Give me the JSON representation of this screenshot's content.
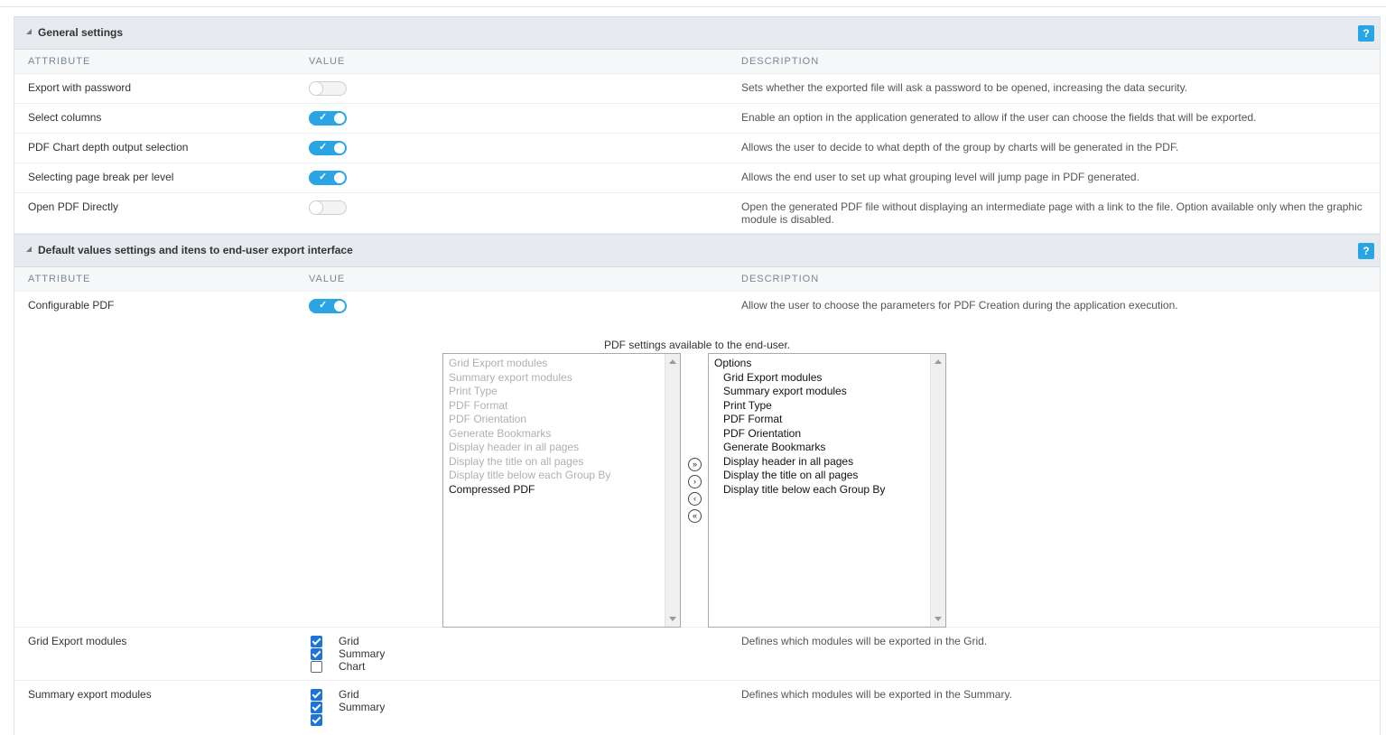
{
  "sections": [
    {
      "title": "General settings",
      "help": "?",
      "columns": {
        "attribute": "ATTRIBUTE",
        "value": "VALUE",
        "description": "DESCRIPTION"
      },
      "rows": [
        {
          "attribute": "Export with password",
          "toggle": "off",
          "description": "Sets whether the exported file will ask a password to be opened, increasing the data security."
        },
        {
          "attribute": "Select columns",
          "toggle": "on",
          "description": "Enable an option in the application generated to allow if the user can choose the fields that will be exported."
        },
        {
          "attribute": "PDF Chart depth output selection",
          "toggle": "on",
          "description": "Allows the user to decide to what depth of the group by charts will be generated in the PDF."
        },
        {
          "attribute": "Selecting page break per level",
          "toggle": "on",
          "description": "Allows the end user to set up what grouping level will jump page in PDF generated."
        },
        {
          "attribute": "Open PDF Directly",
          "toggle": "off",
          "description": "Open the generated PDF file without displaying an intermediate page with a link to the file. Option available only when the graphic module is disabled."
        }
      ]
    },
    {
      "title": "Default values settings and itens to end-user export interface",
      "help": "?",
      "columns": {
        "attribute": "ATTRIBUTE",
        "value": "VALUE",
        "description": "DESCRIPTION"
      },
      "configurable": {
        "attribute": "Configurable PDF",
        "toggle": "on",
        "description": "Allow the user to choose the parameters for PDF Creation during the application execution."
      },
      "pdf_settings": {
        "caption": "PDF settings available to the end-user.",
        "available": [
          {
            "label": "Grid Export modules",
            "disabled": true
          },
          {
            "label": "Summary export modules",
            "disabled": true
          },
          {
            "label": "Print Type",
            "disabled": true
          },
          {
            "label": "PDF Format",
            "disabled": true
          },
          {
            "label": "PDF Orientation",
            "disabled": true
          },
          {
            "label": "Generate Bookmarks",
            "disabled": true
          },
          {
            "label": "Display header in all pages",
            "disabled": true
          },
          {
            "label": "Display the title on all pages",
            "disabled": true
          },
          {
            "label": "Display title below each Group By",
            "disabled": true
          },
          {
            "label": "Compressed PDF",
            "disabled": false
          }
        ],
        "selected_group": "Options",
        "selected": [
          "Grid Export modules",
          "Summary export modules",
          "Print Type",
          "PDF Format",
          "PDF Orientation",
          "Generate Bookmarks",
          "Display header in all pages",
          "Display the title on all pages",
          "Display title below each Group By"
        ],
        "buttons": {
          "add_all": "»",
          "add": "›",
          "remove": "‹",
          "remove_all": "«"
        }
      },
      "grid_export": {
        "attribute": "Grid Export modules",
        "options": [
          {
            "label": "Grid",
            "checked": true
          },
          {
            "label": "Summary",
            "checked": true
          },
          {
            "label": "Chart",
            "checked": false
          }
        ],
        "description": "Defines which modules will be exported in the Grid."
      },
      "summary_export": {
        "attribute": "Summary export modules",
        "options": [
          {
            "label": "Grid",
            "checked": true
          },
          {
            "label": "Summary",
            "checked": true
          }
        ],
        "description": "Defines which modules will be exported in the Summary."
      }
    }
  ],
  "colors": {
    "accent": "#29a5e6",
    "checkbox": "#1d74d8",
    "header_bg": "#e7ebf0"
  }
}
